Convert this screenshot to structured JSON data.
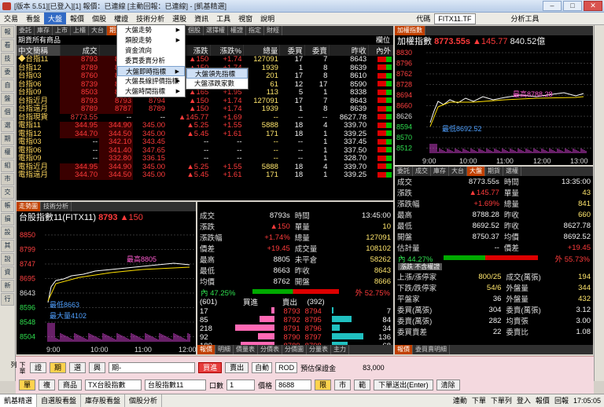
{
  "title": "[版本 5.51][已登入][1] 報價：已連線 [主動回報：已連線] - [凱基精選]",
  "menu": [
    "交易",
    "看盤",
    "大盤",
    "報價",
    "個股",
    "權證",
    "技術分析",
    "選股",
    "資訊",
    "工具",
    "視窗",
    "說明"
  ],
  "menu_code": "代碼",
  "menu_code_value": "FITX11.TF",
  "menu_tool": "分析工具",
  "dropdown": [
    {
      "label": "大盤走勢",
      "arrow": true
    },
    {
      "label": "類股走勢",
      "arrow": true
    },
    {
      "label": "資金流向",
      "arrow": false
    },
    {
      "label": "委買委賣分析",
      "arrow": false
    },
    {
      "label": "大盤即時指標",
      "arrow": true
    },
    {
      "label": "大盤長線評價指標",
      "arrow": true
    },
    {
      "label": "大盤時間指標",
      "arrow": true
    }
  ],
  "submenu": [
    "大盤領先指標",
    "大盤漲跌家數"
  ],
  "left_tabs": [
    "報",
    "看",
    "技",
    "委",
    "自",
    "盤",
    "個",
    "選",
    "期",
    "權",
    "組",
    "市",
    "交",
    "帳",
    "損",
    "設",
    "其",
    "說",
    "資",
    "新",
    "行"
  ],
  "quote": {
    "tabs": [
      "委託",
      "庫存",
      "上市",
      "上櫃",
      "大台",
      "期貨",
      "新聞",
      "報價",
      "指數選",
      "個股",
      "選擇權",
      "權證",
      "指定",
      "財經"
    ],
    "active_tab": "期貨",
    "group": "期貨所有商品",
    "group_right": "欄位",
    "cols": [
      "中文簡稱",
      "成交",
      "買進",
      "賣出",
      "漲跌",
      "漲跌%",
      "總量",
      "委買",
      "委賣",
      "昨收",
      "內外"
    ],
    "rows": [
      [
        "◆台指11",
        "8793",
        "8794",
        "8795",
        "▲150",
        "+1.74",
        "127091",
        "17",
        "7",
        "8643"
      ],
      [
        "台指12",
        "8789",
        "8789",
        "8790",
        "▲150",
        "+1.74",
        "1939",
        "1",
        "8",
        "8639"
      ],
      [
        "台指03",
        "8760",
        "8760",
        "8770",
        "▲140",
        "+1.62",
        "201",
        "17",
        "8",
        "8610"
      ],
      [
        "台指06",
        "8739",
        "8737",
        "8745",
        "▲149",
        "+1.73",
        "61",
        "12",
        "17",
        "8590"
      ],
      [
        "台指09",
        "8503",
        "8499",
        "8515",
        "▲165",
        "+1.95",
        "113",
        "5",
        "1",
        "8338"
      ],
      [
        "台指近月",
        "8793",
        "8793",
        "8794",
        "▲150",
        "+1.74",
        "127091",
        "17",
        "7",
        "8643"
      ],
      [
        "台指遠月",
        "8789",
        "8787",
        "8789",
        "▲150",
        "+1.74",
        "1939",
        "1",
        "8",
        "8639"
      ],
      [
        "台指現貨",
        "8773.55",
        "--",
        "--",
        "▲145.77",
        "+1.69",
        "--",
        "--",
        "--",
        "8627.78"
      ],
      [
        "電指11",
        "344.95",
        "344.90",
        "345.00",
        "▲5.25",
        "+1.55",
        "5888",
        "18",
        "4",
        "339.70"
      ],
      [
        "電指12",
        "344.70",
        "344.50",
        "345.00",
        "▲5.45",
        "+1.61",
        "171",
        "18",
        "1",
        "339.25"
      ],
      [
        "電指03",
        "--",
        "342.10",
        "343.45",
        "--",
        "--",
        "--",
        "--",
        "1",
        "337.45"
      ],
      [
        "電指06",
        "--",
        "341.40",
        "347.65",
        "--",
        "--",
        "--",
        "--",
        "1",
        "337.50"
      ],
      [
        "電指09",
        "--",
        "332.80",
        "336.15",
        "--",
        "--",
        "--",
        "--",
        "1",
        "328.70"
      ],
      [
        "電指近月",
        "344.95",
        "344.90",
        "345.00",
        "▲5.25",
        "+1.55",
        "5888",
        "18",
        "4",
        "339.70"
      ],
      [
        "電指遠月",
        "344.70",
        "344.50",
        "345.00",
        "▲5.45",
        "+1.61",
        "171",
        "18",
        "1",
        "339.25"
      ]
    ]
  },
  "index_chart": {
    "tab": "加權指數",
    "title": "加權指數",
    "value": "8773.55s",
    "change": "▲145.77",
    "volume": "840.52億",
    "high_label": "最高8788.28",
    "low_label": "最低8692.52",
    "yticks": [
      "8830",
      "8796",
      "8762",
      "8728",
      "8694",
      "8660",
      "8626",
      "8594",
      "8570",
      "8512"
    ],
    "xticks": [
      "9:00",
      "10:00",
      "11:00",
      "12:00",
      "13:00"
    ]
  },
  "index_info": {
    "tabs": [
      "委託",
      "成交",
      "庫存",
      "大台",
      "大盤",
      "期貨",
      "選權"
    ],
    "rows": [
      [
        "成交",
        "8773.55s",
        "時間",
        "13:35:00"
      ],
      [
        "漲跌",
        "▲145.77",
        "單量",
        "43"
      ],
      [
        "漲跌幅",
        "+1.69%",
        "總量",
        "841"
      ],
      [
        "最高",
        "8788.28",
        "昨收",
        "660"
      ],
      [
        "最低",
        "8692.52",
        "昨收",
        "8627.78"
      ],
      [
        "開盤",
        "8750.37",
        "均價",
        "8692.52"
      ],
      [
        "估計量",
        "--",
        "價差",
        "+19.45"
      ]
    ],
    "inner": "44.27%",
    "outer": "55.73%",
    "section": "漲跌 不含權證",
    "rows2": [
      [
        "上漲/漲停家",
        "800/25",
        "成交(萬張)",
        "194"
      ],
      [
        "下跌/跌停家",
        "54/6",
        "外盤量",
        "344"
      ],
      [
        "平盤家",
        "36",
        "外盤量",
        "432"
      ],
      [
        "委買(萬張)",
        "304",
        "委賣(萬張)",
        "3.12"
      ],
      [
        "委賣(萬張)",
        "282",
        "均賣張",
        "3.00"
      ],
      [
        "委買賣差",
        "22",
        "委賣比",
        "1.08"
      ]
    ],
    "bottom_tabs": [
      "報價",
      "委買賣明細"
    ]
  },
  "fut_chart": {
    "tabs": [
      "走勢圖",
      "技術分析"
    ],
    "title": "台股指數11(FITX11)",
    "value": "8793",
    "change": "▲150",
    "high_label": "最高8805",
    "low_label": "最低8663",
    "vol_label": "最大量4102",
    "yticks": [
      "8850",
      "8799",
      "8747",
      "8695",
      "8643",
      "8596",
      "8548",
      "8504"
    ],
    "xticks": [
      "9:00",
      "10:00",
      "11:00",
      "12:00"
    ]
  },
  "fut_info": {
    "rows": [
      [
        "成交",
        "8793s",
        "時間",
        "13:45:00"
      ],
      [
        "漲跌",
        "▲150",
        "單量",
        "10"
      ],
      [
        "漲跌幅",
        "+1.74%",
        "總量",
        "127091"
      ],
      [
        "價差",
        "+19.45",
        "成交量",
        "108102"
      ],
      [
        "最高",
        "8805",
        "未平倉",
        "58262"
      ],
      [
        "最低",
        "8663",
        "昨收",
        "8643"
      ],
      [
        "均價",
        "8762",
        "開盤",
        "8666"
      ]
    ],
    "inner": "47.25%",
    "outer": "52.75%",
    "book_head": [
      "(601)",
      "買進",
      "賣出",
      "(392)"
    ],
    "book": [
      [
        "17",
        "8793",
        "8794",
        "7"
      ],
      [
        "85",
        "8792",
        "8795",
        "84"
      ],
      [
        "218",
        "8791",
        "8796",
        "34"
      ],
      [
        "92",
        "8790",
        "8797",
        "136"
      ],
      [
        "189",
        "8789",
        "8798",
        "68"
      ]
    ],
    "bottom_tabs": [
      "報價",
      "明細",
      "價量表",
      "分價表",
      "分價圖",
      "分量表",
      "主力"
    ]
  },
  "order": {
    "side_buttons": [
      "證",
      "期",
      "選",
      "興"
    ],
    "account": "期-",
    "buy": "買進",
    "sell": "賣出",
    "mode": "自動",
    "rod": "ROD",
    "margin_label": "預估保證金",
    "margin": "83,000",
    "row2_buttons": [
      "單",
      "複"
    ],
    "product": "商品",
    "product_val": "TX台股指數",
    "month_val": "台股指數11",
    "qty_label": "口數",
    "qty": "1",
    "price_label": "價格",
    "price": "8688",
    "limit": "限",
    "market": "市",
    "range": "範",
    "submit": "下單送出(Enter)",
    "clear": "清除",
    "side_label": "下單列"
  },
  "status": {
    "tabs": [
      "凱基精選",
      "自選股看盤",
      "庫存股看盤",
      "個股分析"
    ],
    "active": "凱基精選",
    "right": [
      "連動",
      "下單",
      "下單列",
      "登入",
      "報價",
      "回報",
      "17:05:05"
    ]
  }
}
